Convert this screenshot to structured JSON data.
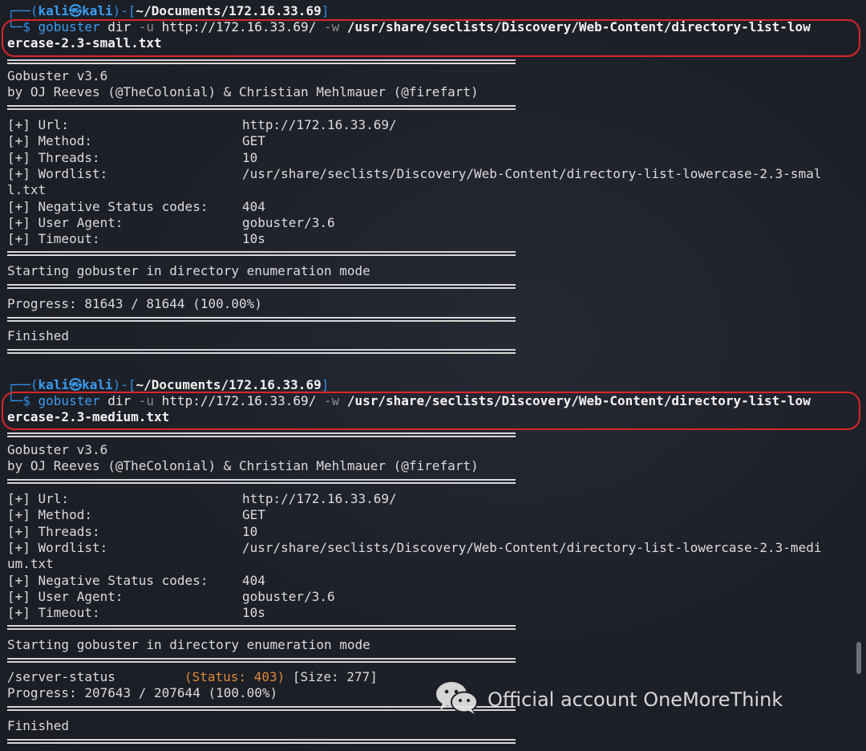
{
  "prompt": {
    "top": "┌──(",
    "user": "kali㉿kali",
    "mid": ")-[",
    "path": "~/Documents/172.16.33.69",
    "end": "]",
    "bottom": "└─$ "
  },
  "run1": {
    "cmd": "gobuster",
    "args1": " dir ",
    "flag_u": "-u",
    "url": " http://172.16.33.69/ ",
    "flag_w": "-w",
    "wordlist_a": " /usr/share/seclists/Discovery/Web-Content/directory-list-low",
    "wordlist_b": "ercase-2.3-small.txt",
    "banner1": "Gobuster v3.6",
    "banner2": "by OJ Reeves (@TheColonial) & Christian Mehlmauer (@firefart)",
    "rows": [
      {
        "key": "[+] Url:",
        "val": "http://172.16.33.69/"
      },
      {
        "key": "[+] Method:",
        "val": "GET"
      },
      {
        "key": "[+] Threads:",
        "val": "10"
      },
      {
        "key": "[+] Wordlist:",
        "val": "/usr/share/seclists/Discovery/Web-Content/directory-list-lowercase-2.3-smal"
      },
      {
        "key": "l.txt",
        "val": ""
      },
      {
        "key": "[+] Negative Status codes:",
        "val": "404"
      },
      {
        "key": "[+] User Agent:",
        "val": "gobuster/3.6"
      },
      {
        "key": "[+] Timeout:",
        "val": "10s"
      }
    ],
    "starting": "Starting gobuster in directory enumeration mode",
    "progress": "Progress: 81643 / 81644 (100.00%)",
    "finished": "Finished"
  },
  "run2": {
    "cmd": "gobuster",
    "args1": " dir ",
    "flag_u": "-u",
    "url": " http://172.16.33.69/ ",
    "flag_w": "-w",
    "wordlist_a": " /usr/share/seclists/Discovery/Web-Content/directory-list-low",
    "wordlist_b": "ercase-2.3-medium.txt",
    "banner1": "Gobuster v3.6",
    "banner2": "by OJ Reeves (@TheColonial) & Christian Mehlmauer (@firefart)",
    "rows": [
      {
        "key": "[+] Url:",
        "val": "http://172.16.33.69/"
      },
      {
        "key": "[+] Method:",
        "val": "GET"
      },
      {
        "key": "[+] Threads:",
        "val": "10"
      },
      {
        "key": "[+] Wordlist:",
        "val": "/usr/share/seclists/Discovery/Web-Content/directory-list-lowercase-2.3-medi"
      },
      {
        "key": "um.txt",
        "val": ""
      },
      {
        "key": "[+] Negative Status codes:",
        "val": "404"
      },
      {
        "key": "[+] User Agent:",
        "val": "gobuster/3.6"
      },
      {
        "key": "[+] Timeout:",
        "val": "10s"
      }
    ],
    "starting": "Starting gobuster in directory enumeration mode",
    "result_path": "/server-status",
    "result_status": "(Status: 403)",
    "result_size": "[Size: 277]",
    "progress": "Progress: 207643 / 207644 (100.00%)",
    "finished": "Finished"
  },
  "watermark": {
    "text": "Official account OneMoreThink",
    "icon": "wechat-icon"
  },
  "colors": {
    "background": "#1f2129",
    "prompt_blue": "#3b9cf0",
    "highlight_red": "#d8262a",
    "status_orange": "#e0893a"
  }
}
